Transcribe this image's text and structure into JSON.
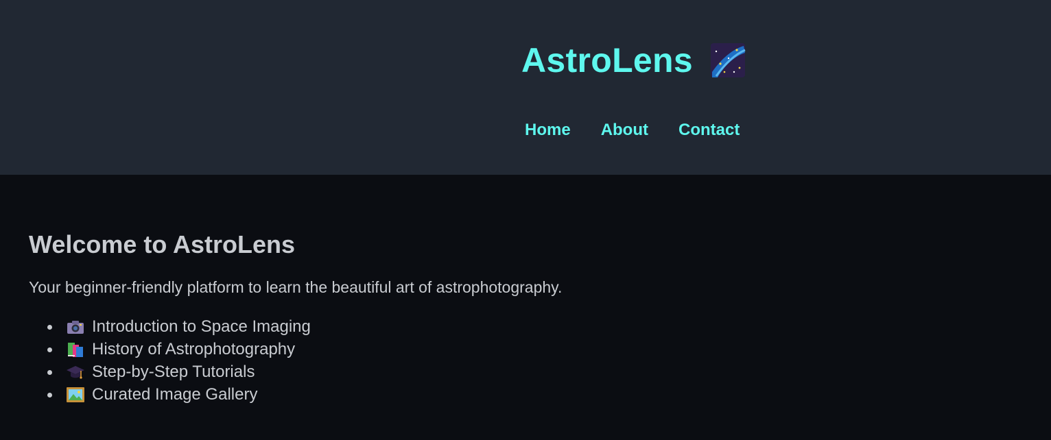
{
  "header": {
    "brand_title": "AstroLens",
    "brand_icon": "milky-way-icon",
    "nav": [
      {
        "label": "Home"
      },
      {
        "label": "About"
      },
      {
        "label": "Contact"
      }
    ]
  },
  "main": {
    "heading": "Welcome to AstroLens",
    "intro": "Your beginner-friendly platform to learn the beautiful art of astrophotography.",
    "features": [
      {
        "icon": "camera-icon",
        "label": "Introduction to Space Imaging"
      },
      {
        "icon": "books-icon",
        "label": "History of Astrophotography"
      },
      {
        "icon": "graduation-cap-icon",
        "label": "Step-by-Step Tutorials"
      },
      {
        "icon": "framed-picture-icon",
        "label": "Curated Image Gallery"
      }
    ]
  },
  "colors": {
    "header_bg": "#212833",
    "page_bg": "#0b0d12",
    "accent": "#5ef7ee",
    "text": "#c9ccd1"
  }
}
